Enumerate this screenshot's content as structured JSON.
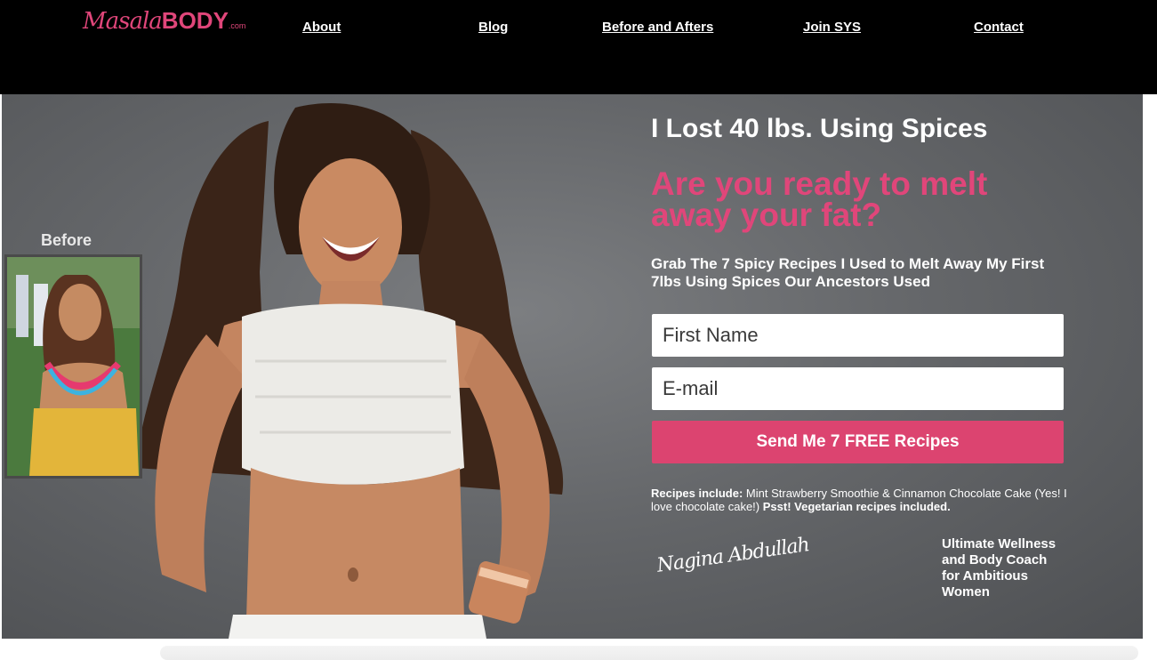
{
  "nav": {
    "logo": {
      "script": "Masala",
      "bold": "BODY",
      "suffix": ".com"
    },
    "links": [
      "About ",
      "Blog",
      "Before and Afters",
      "Join SYS",
      "Contact"
    ]
  },
  "hero": {
    "before_label": "Before",
    "headline": "I Lost 40 lbs. Using Spices",
    "subheadline": "Are you ready to melt away your fat?",
    "lead": "Grab The 7 Spicy Recipes I Used to Melt Away My First 7lbs Using Spices Our Ancestors Used",
    "form": {
      "first_name_placeholder": "First Name",
      "email_placeholder": "E-mail",
      "submit_label": "Send Me 7 FREE Recipes"
    },
    "recipes": {
      "prefix": "Recipes include:",
      "body": " Mint Strawberry Smoothie & Cinnamon Chocolate Cake (Yes! I love chocolate cake!) ",
      "suffix": "Psst! Vegetarian recipes included."
    },
    "signature": "Nagina Abdullah",
    "tagline": "Ultimate Wellness and Body Coach for Ambitious Women"
  },
  "colors": {
    "accent": "#dc4470",
    "nav_bg": "#000000",
    "hero_bg": "#65676a"
  }
}
